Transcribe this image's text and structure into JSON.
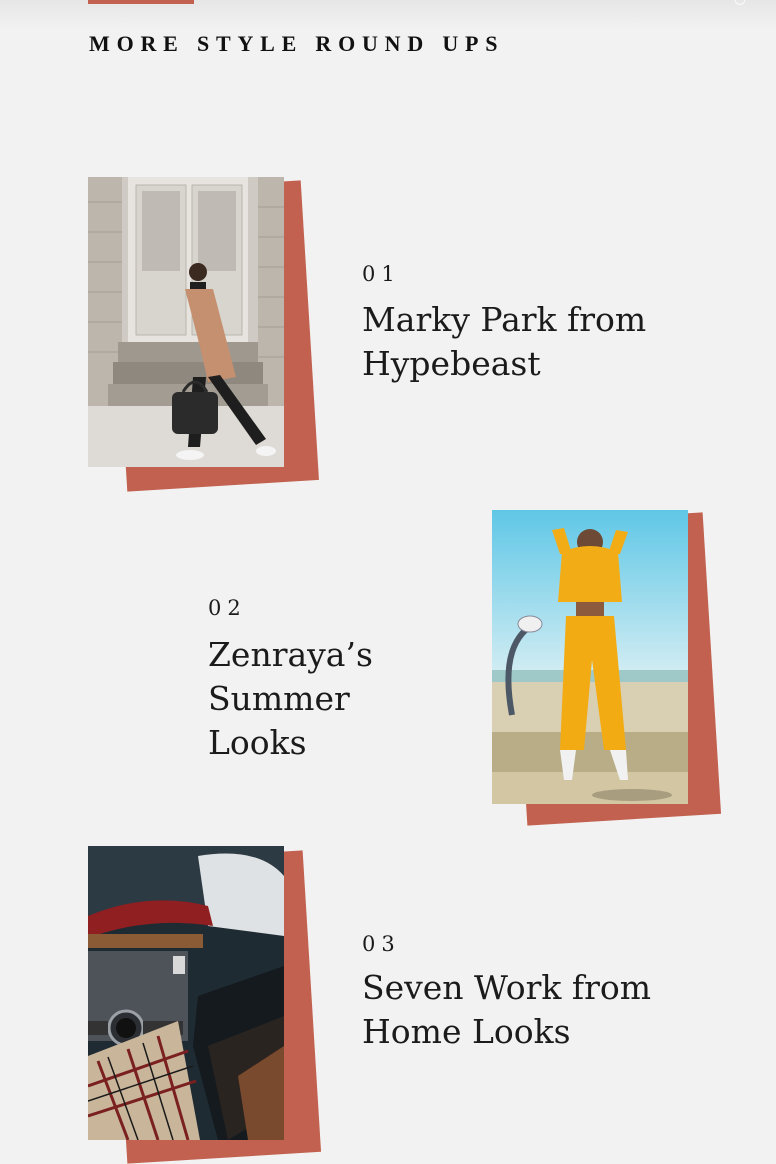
{
  "header": {
    "section_title": "MORE STYLE ROUND UPS"
  },
  "roundups": [
    {
      "index": "01",
      "title": "Marky Park from Hypebeast",
      "image": "man-walking-with-bag-photo"
    },
    {
      "index": "02",
      "title": "Zenraya’s Summer Looks",
      "image": "woman-yellow-tracksuit-photo"
    },
    {
      "index": "03",
      "title": "Seven Work from Home Looks",
      "image": "watch-and-clothing-flatlay-photo"
    }
  ],
  "colors": {
    "accent": "#c2614f",
    "background": "#f2f2f2",
    "text": "#1b1b1b"
  }
}
